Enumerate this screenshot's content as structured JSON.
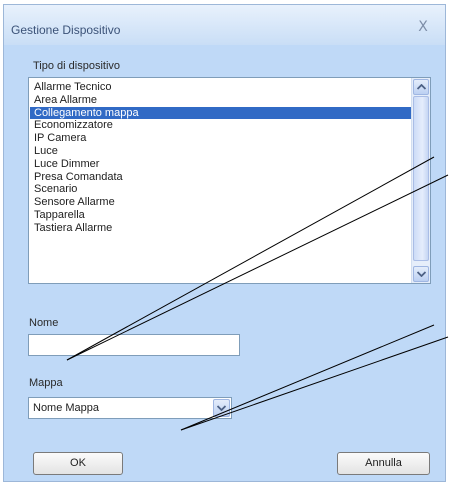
{
  "dialog": {
    "title": "Gestione Dispositivo",
    "close_glyph": "X"
  },
  "device_type": {
    "label": "Tipo di dispositivo",
    "items": [
      "Allarme Tecnico",
      "Area Allarme",
      "Collegamento mappa",
      "Economizzatore",
      "IP Camera",
      "Luce",
      "Luce Dimmer",
      "Presa Comandata",
      "Scenario",
      "Sensore Allarme",
      "Tapparella",
      "Tastiera Allarme"
    ],
    "selected": "Collegamento mappa"
  },
  "name_field": {
    "label": "Nome",
    "value": ""
  },
  "map_field": {
    "label": "Mappa",
    "selected": "Nome Mappa"
  },
  "buttons": {
    "ok": "OK",
    "cancel": "Annulla"
  },
  "icons": {
    "close": "close-icon",
    "scroll_up": "chevron-up-icon",
    "scroll_down": "chevron-down-icon",
    "dropdown": "chevron-down-icon"
  },
  "colors": {
    "dialog_background": "#bfd9f7",
    "selection": "#316ac5",
    "annotation_line": "#000000"
  }
}
